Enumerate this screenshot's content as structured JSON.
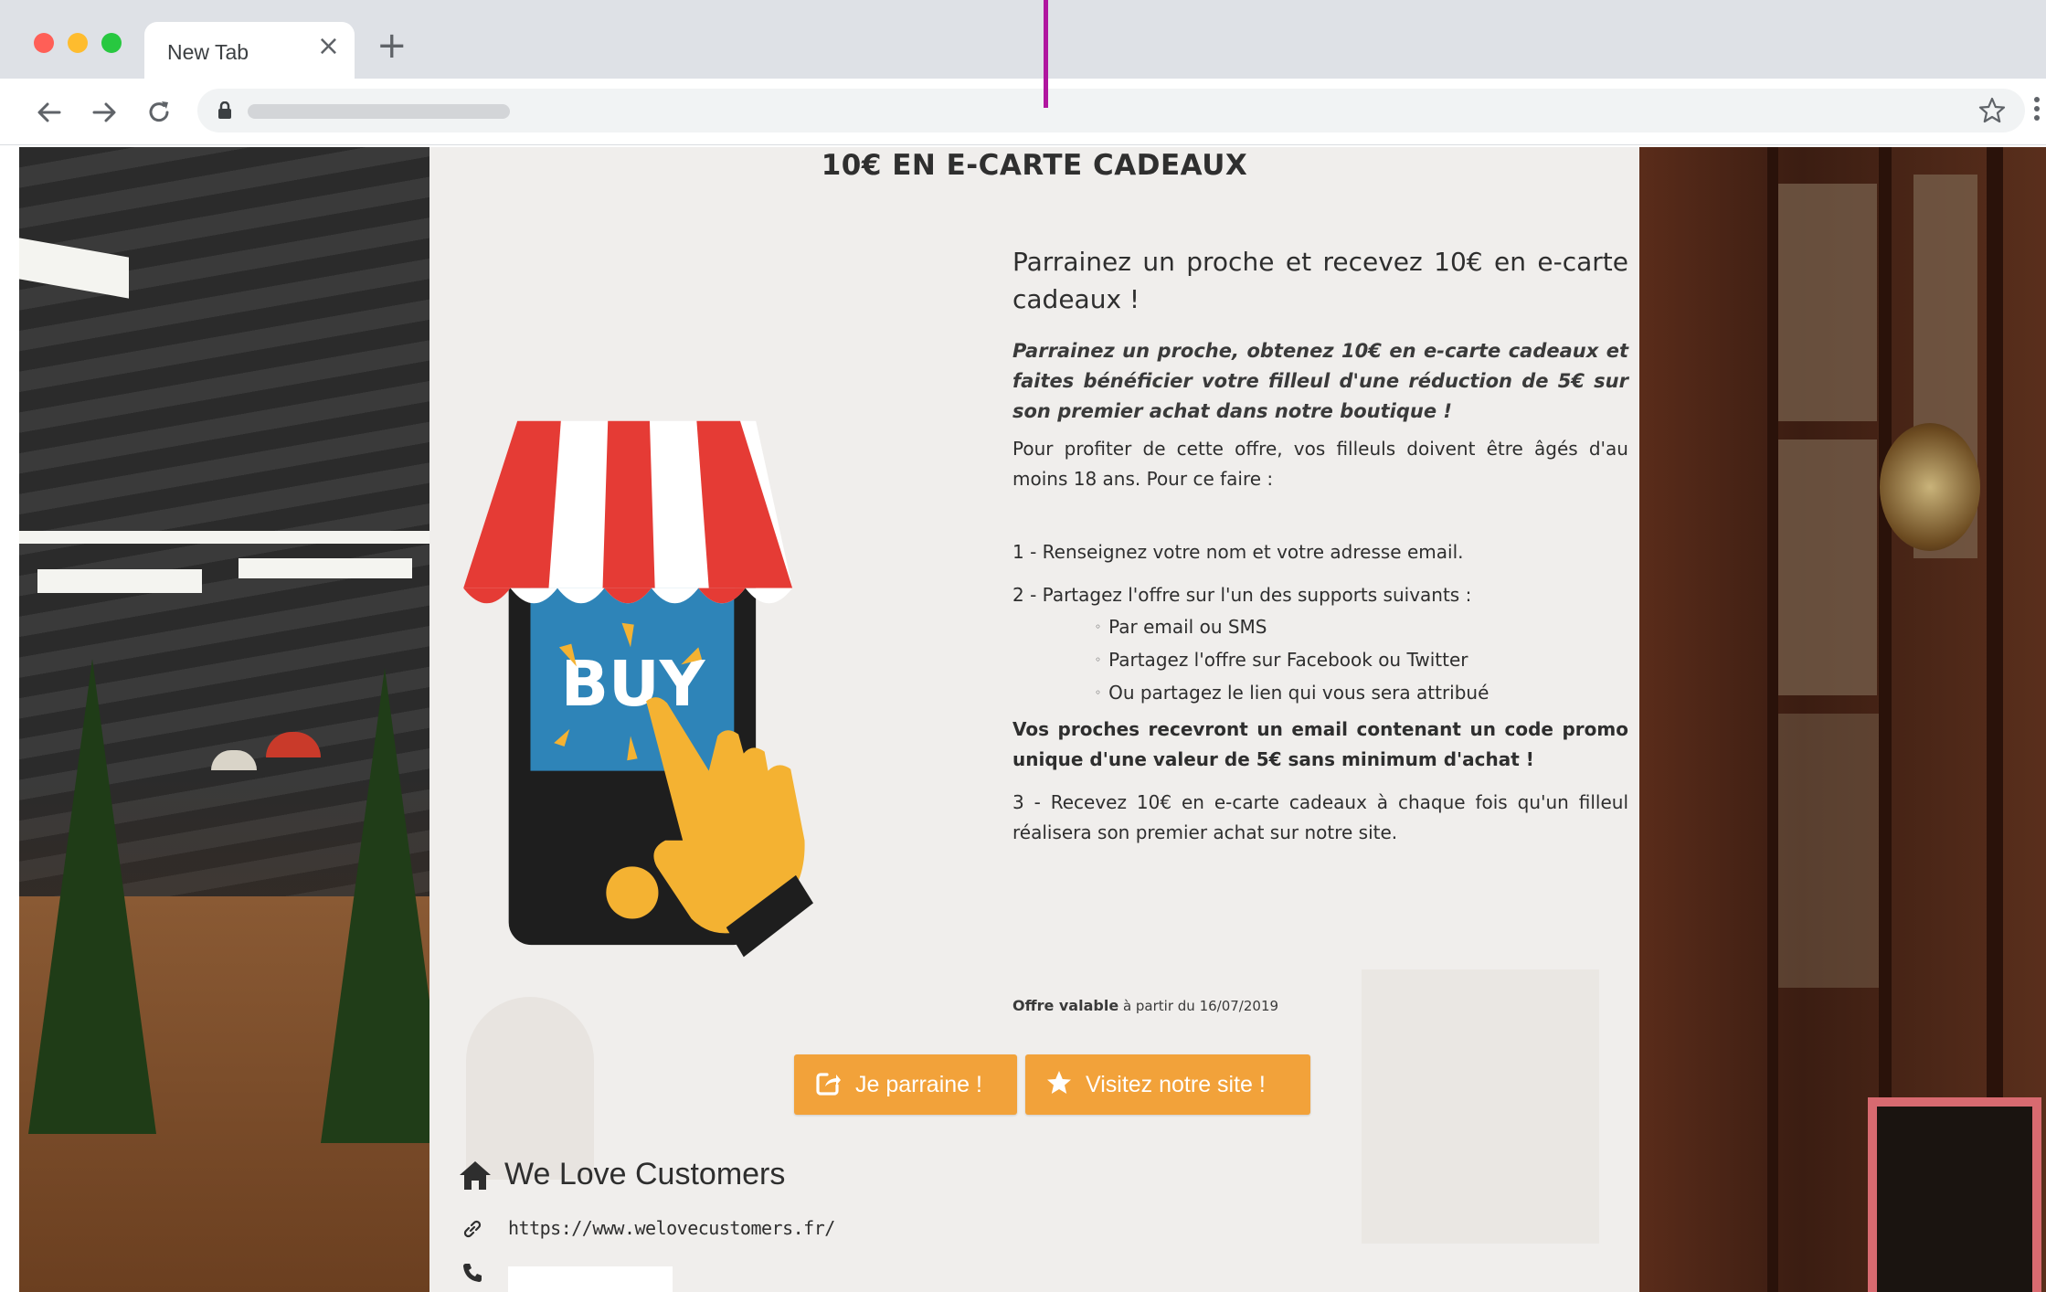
{
  "browser": {
    "tab_title": "New Tab",
    "tab_close_glyph": "×",
    "new_tab_glyph": "+",
    "icons": [
      "back-arrow-icon",
      "forward-arrow-icon",
      "reload-icon",
      "lock-icon",
      "bookmark-star-icon",
      "menu-dots-icon"
    ]
  },
  "page": {
    "headline": "10€ EN E-CARTE CADEAUX",
    "illustration_text": "BUY",
    "title": "Parrainez un proche et recevez 10€ en e-carte cadeaux !",
    "intro": "Parrainez un proche, obtenez 10€ en e-carte cadeaux et faites bénéficier votre filleul d'une réduction de 5€ sur son premier achat dans notre boutique !",
    "conditions": "Pour profiter de cette offre, vos filleuls doivent être âgés d'au moins 18 ans. Pour ce faire :",
    "step1": "1 - Renseignez votre nom et votre adresse email.",
    "step2": "2 - Partagez l'offre sur l'un des supports suivants :",
    "share_options": [
      "Par email ou SMS",
      "Partagez l'offre sur Facebook ou Twitter",
      "Ou partagez le lien qui vous sera attribué"
    ],
    "emphasis": "Vos proches recevront un email contenant un code promo unique d'une valeur de 5€ sans minimum d'achat !",
    "step3": "3 - Recevez 10€ en e-carte cadeaux à chaque fois qu'un filleul réalisera son premier achat sur notre site.",
    "validity_prefix": "Offre valable",
    "validity_rest": "à partir du 16/07/2019",
    "buttons": {
      "refer": "Je parraine !",
      "visit": "Visitez notre site !"
    },
    "company": {
      "name": "We Love Customers",
      "website": "https://www.welovecustomers.fr/"
    }
  },
  "colors": {
    "button_orange": "#f2a23a",
    "awning_red": "#e53b35",
    "tablet_blue": "#2e84b8",
    "hand_yellow": "#f4b232",
    "annotation_magenta": "#b0169f"
  }
}
